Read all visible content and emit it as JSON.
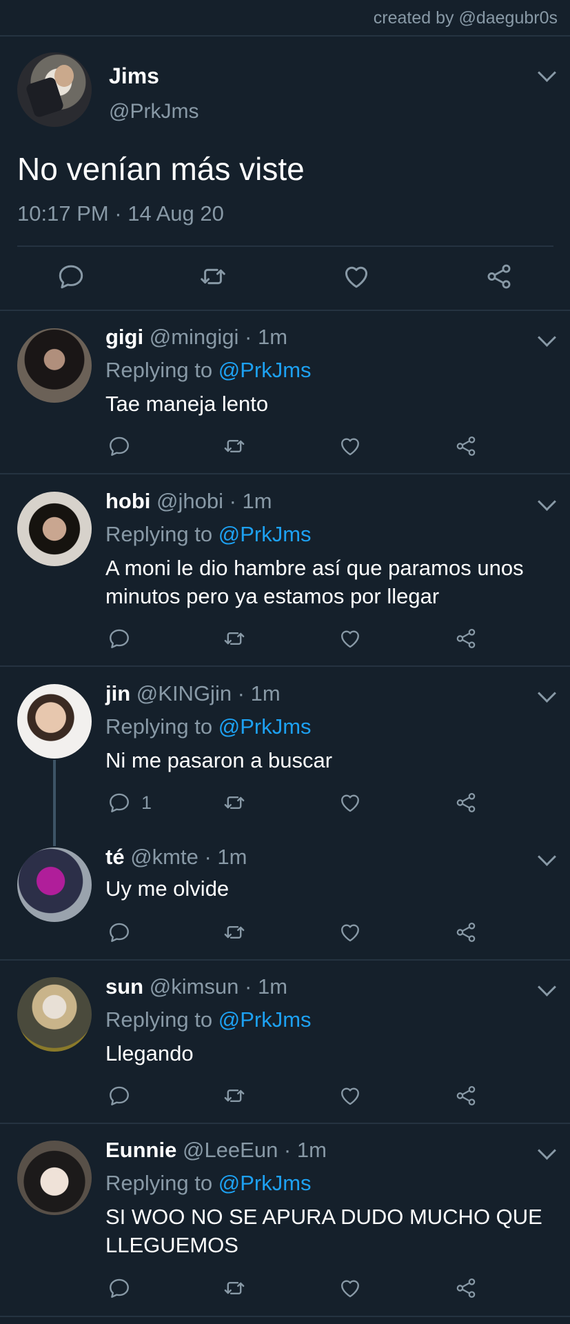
{
  "credit": "created by @daegubr0s",
  "main_tweet": {
    "name": "Jims",
    "handle": "@PrkJms",
    "text": "No venían más viste",
    "time": "10:17 PM · 14 Aug 20"
  },
  "replies": [
    {
      "name": "gigi",
      "meta": "@mingigi · 1m",
      "replying_prefix": "Replying to",
      "mention": "@PrkJms",
      "text": "Tae maneja lento",
      "reply_count": ""
    },
    {
      "name": "hobi",
      "meta": "@jhobi · 1m",
      "replying_prefix": "Replying to",
      "mention": "@PrkJms",
      "text": "A moni le dio hambre así que paramos unos minutos pero ya estamos por llegar",
      "reply_count": ""
    },
    {
      "name": "jin",
      "meta": "@KINGjin · 1m",
      "replying_prefix": "Replying to",
      "mention": "@PrkJms",
      "text": "Ni me pasaron a buscar",
      "reply_count": "1"
    },
    {
      "name": "té",
      "meta": "@kmte · 1m",
      "text": "Uy me olvide",
      "reply_count": ""
    },
    {
      "name": "sun",
      "meta": "@kimsun · 1m",
      "replying_prefix": "Replying to",
      "mention": "@PrkJms",
      "text": "Llegando",
      "reply_count": ""
    },
    {
      "name": "Eunnie",
      "meta": "@LeeEun · 1m",
      "replying_prefix": "Replying to",
      "mention": "@PrkJms",
      "text": "SI WOO NO SE APURA DUDO MUCHO QUE LLEGUEMOS",
      "reply_count": ""
    }
  ],
  "icons": {
    "reply": "speech-bubble-icon",
    "retweet": "retweet-icon",
    "like": "heart-icon",
    "share": "share-icon",
    "more": "chevron-down-icon"
  },
  "colors": {
    "background": "#15202b",
    "muted": "#8899a6",
    "link": "#1da1f2",
    "divider": "#253341"
  }
}
